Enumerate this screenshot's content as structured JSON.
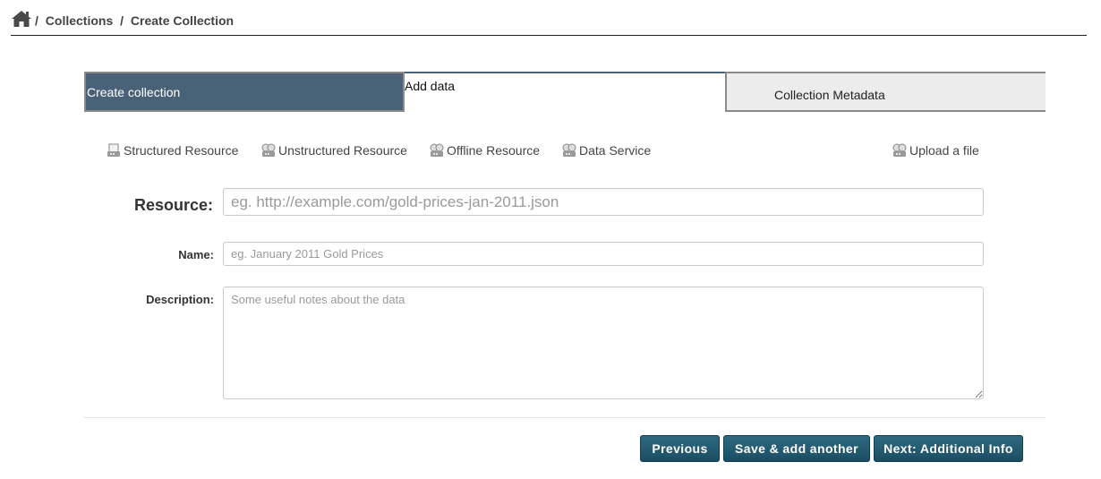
{
  "breadcrumb": {
    "home_icon": "home-icon",
    "separator": "/",
    "items": [
      "Collections",
      "Create Collection"
    ]
  },
  "steps": [
    {
      "label": "Create collection",
      "state": "active"
    },
    {
      "label": "Add data",
      "state": "current"
    },
    {
      "label": "Collection Metadata",
      "state": "inactive"
    }
  ],
  "resource_types": [
    {
      "label": "Structured Resource",
      "icon": "structured-resource-icon"
    },
    {
      "label": "Unstructured Resource",
      "icon": "unstructured-resource-icon"
    },
    {
      "label": "Offline Resource",
      "icon": "offline-resource-icon"
    },
    {
      "label": "Data Service",
      "icon": "data-service-icon"
    },
    {
      "label": "Upload a file",
      "icon": "upload-file-icon"
    }
  ],
  "form": {
    "resource": {
      "label": "Resource:",
      "value": "",
      "placeholder": "eg. http://example.com/gold-prices-jan-2011.json"
    },
    "name": {
      "label": "Name:",
      "value": "",
      "placeholder": "eg. January 2011 Gold Prices"
    },
    "description": {
      "label": "Description:",
      "value": "",
      "placeholder": "Some useful notes about the data"
    }
  },
  "buttons": {
    "previous": "Previous",
    "save_add": "Save & add another",
    "next": "Next: Additional Info"
  },
  "colors": {
    "step_active": "#4a6278",
    "step_inactive": "#ececec",
    "button": "#1f5468"
  }
}
